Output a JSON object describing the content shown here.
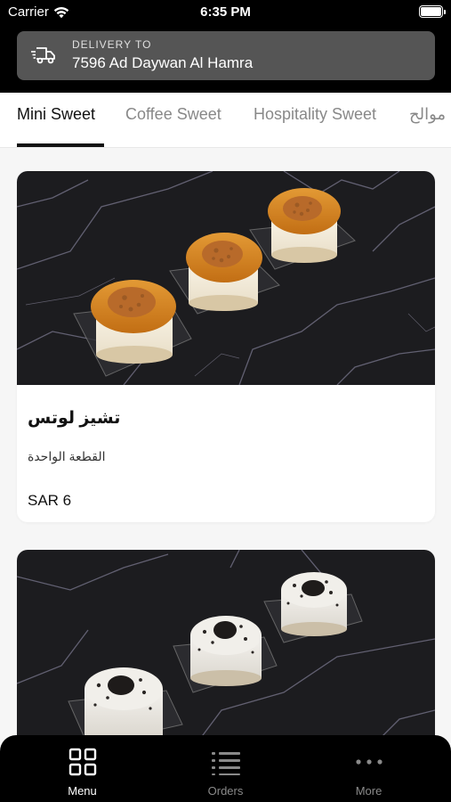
{
  "status_bar": {
    "carrier": "Carrier",
    "time": "6:35 PM"
  },
  "delivery": {
    "label": "DELIVERY TO",
    "address": "7596 Ad Daywan Al Hamra",
    "icon": "truck-icon"
  },
  "tabs": [
    {
      "label": "Mini Sweet",
      "active": true
    },
    {
      "label": "Coffee Sweet",
      "active": false
    },
    {
      "label": "Hospitality Sweet",
      "active": false
    },
    {
      "label": "موالح",
      "active": false
    }
  ],
  "products": [
    {
      "name": "تشيز لوتس",
      "description": "القطعة الواحدة",
      "price": "SAR 6"
    }
  ],
  "bottom_nav": [
    {
      "label": "Menu",
      "icon": "grid-icon",
      "active": true
    },
    {
      "label": "Orders",
      "icon": "list-icon",
      "active": false
    },
    {
      "label": "More",
      "icon": "more-dots-icon",
      "active": false
    }
  ],
  "colors": {
    "header_bg": "#000000",
    "delivery_bar_bg": "#555555",
    "page_bg": "#f6f6f6",
    "marble": "#1c1c1e",
    "caramel": "#d4801f"
  }
}
